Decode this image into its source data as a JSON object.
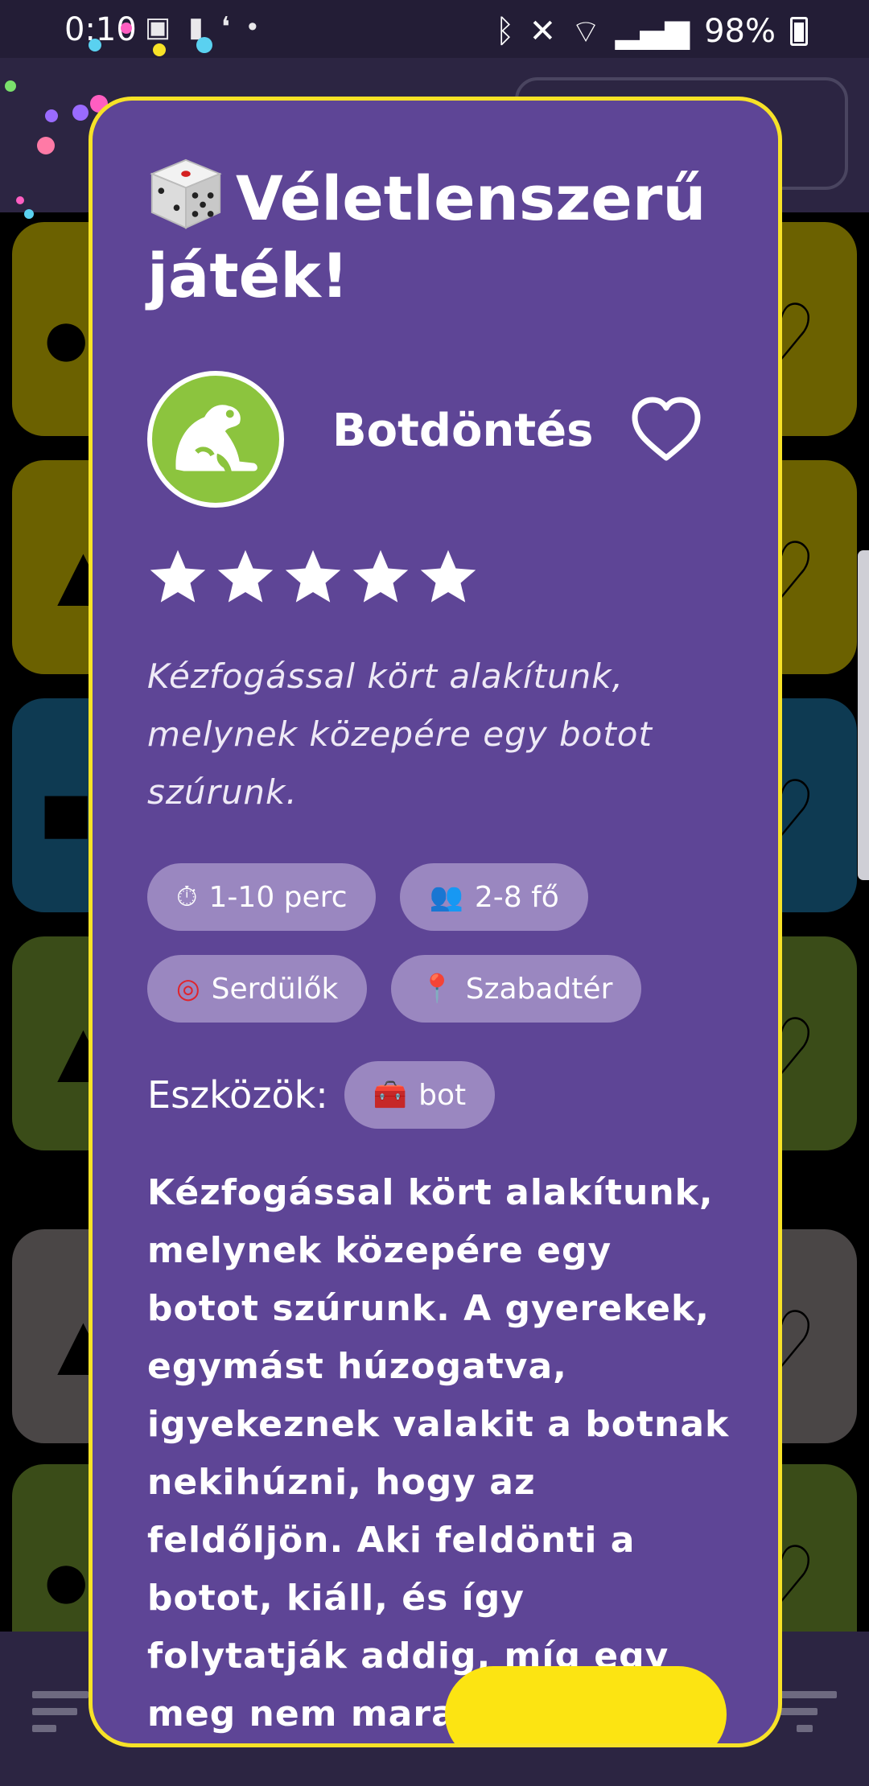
{
  "status_bar": {
    "time": "0:10",
    "battery": "98%"
  },
  "background_list": {
    "tile_colors": [
      "#6b6100",
      "#6b6100",
      "#0e3a52",
      "#3a4c18",
      "#4a4646",
      "#3a4c18"
    ]
  },
  "modal": {
    "title": "Véletlenszerű játék!",
    "game": {
      "name": "Botdöntés",
      "rating": 5,
      "rating_max": 5,
      "short_description": "Kézfogással kört alakítunk, melynek közepére egy botot szúrunk.",
      "tags": {
        "duration": "1-10 perc",
        "players": "2-8 fő",
        "age_group": "Serdülők",
        "location": "Szabadtér"
      },
      "tools_label": "Eszközök:",
      "tools": [
        "bot"
      ],
      "long_description": "Kézfogással kört alakítunk, melynek közepére egy botot szúrunk. A gyerekek, egymást húzogatva, igyekeznek valakit a botnak nekihúzni, hogy az feldőljön. Aki feldönti a botot, kiáll, és így folytatják addig, míg egy meg nem marad."
    },
    "icons": {
      "title": "dice-icon",
      "avatar": "frog-icon",
      "favorite": "heart-outline-icon",
      "duration": "stopwatch-icon",
      "players": "people-icon",
      "age_group": "target-icon",
      "location": "pin-icon",
      "tool": "toolbox-icon"
    },
    "colors": {
      "modal_bg": "#5e4596",
      "modal_border": "#f7e227",
      "chip_bg": "#9a87c0",
      "avatar_bg": "#8cc43e",
      "cta": "#fce412"
    }
  }
}
